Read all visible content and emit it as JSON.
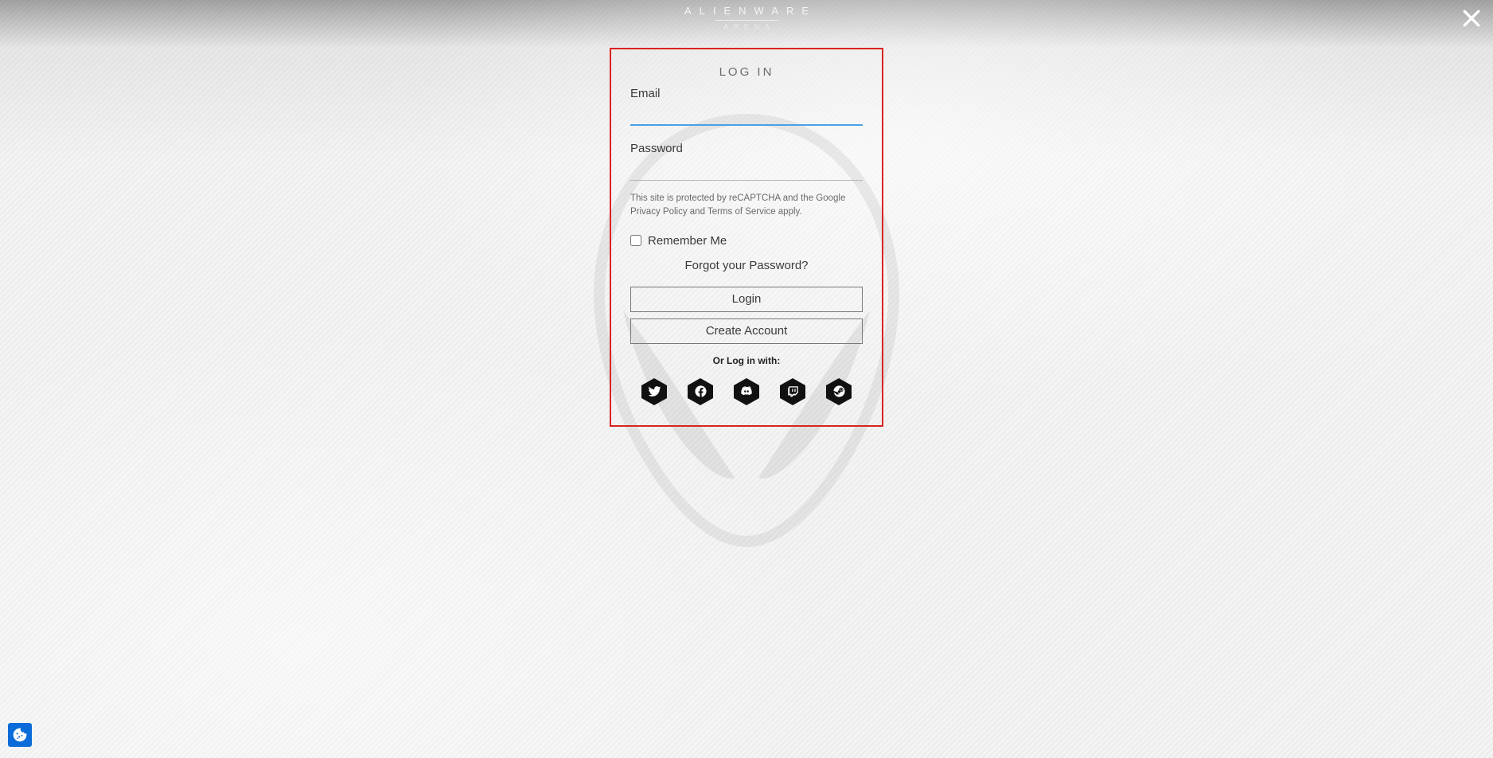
{
  "brand": {
    "name": "ALIENWARE",
    "sub": "ARENA"
  },
  "login": {
    "title": "LOG IN",
    "email_label": "Email",
    "password_label": "Password",
    "recaptcha_pre": "This site is protected by reCAPTCHA and the Google ",
    "recaptcha_privacy": "Privacy Policy",
    "recaptcha_and": " and ",
    "recaptcha_tos": "Terms of Service",
    "recaptcha_post": " apply.",
    "remember_label": "Remember Me",
    "forgot_label": "Forgot your Password?",
    "login_button": "Login",
    "create_button": "Create Account",
    "or_label": "Or Log in with:",
    "social": [
      "twitter",
      "facebook",
      "discord",
      "twitch",
      "steam"
    ]
  }
}
